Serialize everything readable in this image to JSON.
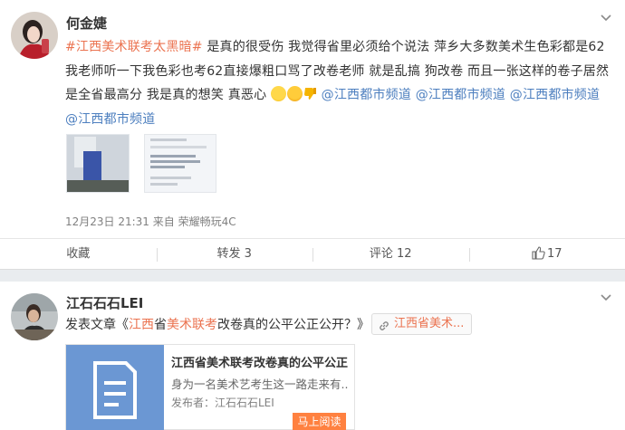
{
  "post1": {
    "author": "何金婕",
    "hashtag": "#江西美术联考太黑暗#",
    "body": " 是真的很受伤 我觉得省里必须给个说法 萍乡大多数美术生色彩都是62 我老师听一下我色彩也考62直接爆粗口骂了改卷老师 就是乱搞 狗改卷 而且一张这样的卷子居然是全省最高分 我是真的想笑 真恶心",
    "mentions": [
      "@江西都市频道",
      "@江西都市频道",
      "@江西都市频道",
      "@江西都市频道"
    ],
    "timestamp": "12月23日 21:31",
    "source": "来自 荣耀畅玩4C",
    "actions": {
      "collect": "收藏",
      "repost": "转发 3",
      "comment": "评论 12",
      "like": "17"
    }
  },
  "post2": {
    "author": "江石石石LEI",
    "article_prefix": "发表文章《",
    "article_parts": [
      "江西",
      "省",
      "美术联考",
      "改卷真的公平公正公开？》"
    ],
    "chip_label": "江西省美术...",
    "article_card": {
      "title": "江西省美术联考改卷真的公平公正...",
      "desc": "身为一名美术艺考生这一路走来有...",
      "publisher": "发布者：江石石石LEI",
      "button": "马上阅读"
    }
  },
  "colors": {
    "accent_orange": "#eb7350",
    "link_blue": "#4d7fbf",
    "button_orange": "#ff8140",
    "article_thumb": "#6b97d3"
  },
  "icons": [
    "chevron-down-icon",
    "thumbs-up-icon",
    "link-icon",
    "document-icon"
  ]
}
